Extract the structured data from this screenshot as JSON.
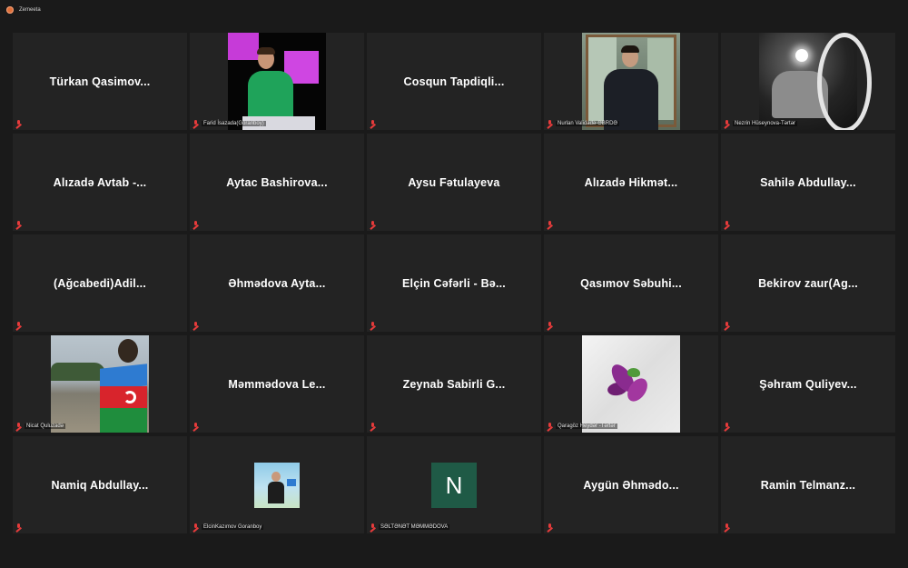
{
  "window": {
    "title": "Zemeeta"
  },
  "participants": [
    {
      "name": "Türkan  Qasimov...",
      "label": "",
      "type": "name"
    },
    {
      "name": "",
      "label": "Farid İsazada(Göranboy)",
      "type": "video-farid"
    },
    {
      "name": "Cosqun  Tapdiqli...",
      "label": "",
      "type": "name"
    },
    {
      "name": "",
      "label": "Nurlan Validadə-ƏBRDƏ",
      "type": "video-nurlan"
    },
    {
      "name": "",
      "label": "Nezrin Hüseynova-Tərtər",
      "type": "video-nezrin"
    },
    {
      "name": "Alızadə  Avtab  -...",
      "label": "",
      "type": "name"
    },
    {
      "name": "Aytac  Bashirova...",
      "label": "",
      "type": "name"
    },
    {
      "name": "Aysu  Fətulayeva",
      "label": "",
      "type": "name"
    },
    {
      "name": "Alızadə  Hikmət...",
      "label": "",
      "type": "name"
    },
    {
      "name": "Sahilə  Abdullay...",
      "label": "",
      "type": "name"
    },
    {
      "name": "(Ağcabedi)Adil...",
      "label": "",
      "type": "name"
    },
    {
      "name": "Əhmədova  Ayta...",
      "label": "",
      "type": "name"
    },
    {
      "name": "Elçin  Cəfərli  -  Bə...",
      "label": "",
      "type": "name"
    },
    {
      "name": "Qasımov  Səbuhi...",
      "label": "",
      "type": "name"
    },
    {
      "name": "Bekirov  zaur(Ag...",
      "label": "",
      "type": "name"
    },
    {
      "name": "",
      "label": "Nicat Quluzadə",
      "type": "video-nicat"
    },
    {
      "name": "Məmmədova  Le...",
      "label": "",
      "type": "name"
    },
    {
      "name": "Zeynab  Sabirli  G...",
      "label": "",
      "type": "name"
    },
    {
      "name": "",
      "label": "Qaragöz Heydər -Tərtər",
      "type": "video-qaragoz"
    },
    {
      "name": "Şəhram  Quliyev...",
      "label": "",
      "type": "name"
    },
    {
      "name": "Namiq  Abdullay...",
      "label": "",
      "type": "name"
    },
    {
      "name": "",
      "label": "ElcinKazımov Goranboy",
      "type": "avatar-elcin"
    },
    {
      "name": "",
      "label": "SƏLTƏNƏT MƏMMƏDOVA",
      "type": "avatar-letter",
      "letter": "N"
    },
    {
      "name": "Aygün  Əhmədo...",
      "label": "",
      "type": "name"
    },
    {
      "name": "Ramin  Telmanz...",
      "label": "",
      "type": "name"
    }
  ],
  "icons": {
    "muted": "mic-muted-icon"
  },
  "colors": {
    "tile_bg": "#232323",
    "muted_red": "#e63b3b",
    "avatar_green": "#1f5a46"
  }
}
